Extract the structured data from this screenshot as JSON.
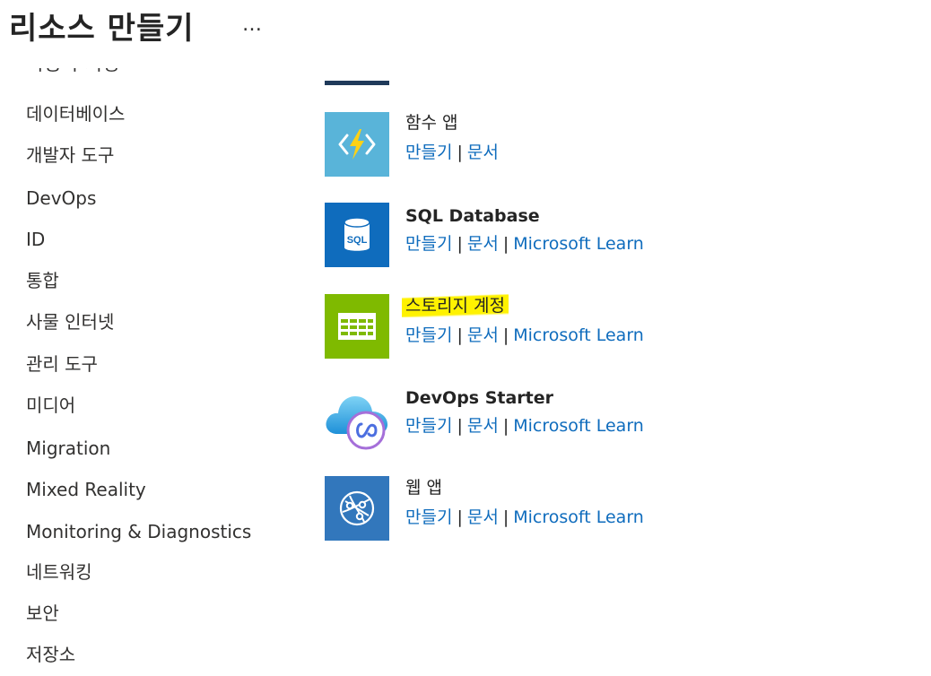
{
  "header": {
    "title": "리소스 만들기",
    "more_label": "…"
  },
  "sidebar": {
    "cut_item": "사용자 지정",
    "items": [
      {
        "label": "데이터베이스"
      },
      {
        "label": "개발자 도구"
      },
      {
        "label": "DevOps"
      },
      {
        "label": "ID"
      },
      {
        "label": "통합"
      },
      {
        "label": "사물 인터넷"
      },
      {
        "label": "관리 도구"
      },
      {
        "label": "미디어"
      },
      {
        "label": "Migration"
      },
      {
        "label": "Mixed Reality"
      },
      {
        "label": "Monitoring & Diagnostics"
      },
      {
        "label": "네트워킹"
      },
      {
        "label": "보안"
      },
      {
        "label": "저장소"
      }
    ]
  },
  "services": [
    {
      "name": "함수 앱",
      "icon": "function-app-icon",
      "icon_color": "#59b4d9",
      "create_label": "만들기",
      "docs_label": "문서",
      "learn_label": ""
    },
    {
      "name": "SQL Database",
      "icon": "sql-database-icon",
      "icon_color": "#0f6cbd",
      "icon_text": "SQL",
      "create_label": "만들기",
      "docs_label": "문서",
      "learn_label": "Microsoft Learn"
    },
    {
      "name": "스토리지 계정",
      "icon": "storage-account-icon",
      "icon_color": "#7fba00",
      "highlighted": true,
      "create_label": "만들기",
      "docs_label": "문서",
      "learn_label": "Microsoft Learn"
    },
    {
      "name": "DevOps Starter",
      "icon": "devops-starter-icon",
      "icon_color": "#50c7f0",
      "create_label": "만들기",
      "docs_label": "문서",
      "learn_label": "Microsoft Learn"
    },
    {
      "name": "웹 앱",
      "icon": "web-app-icon",
      "icon_color": "#3277bc",
      "create_label": "만들기",
      "docs_label": "문서",
      "learn_label": "Microsoft Learn"
    }
  ]
}
